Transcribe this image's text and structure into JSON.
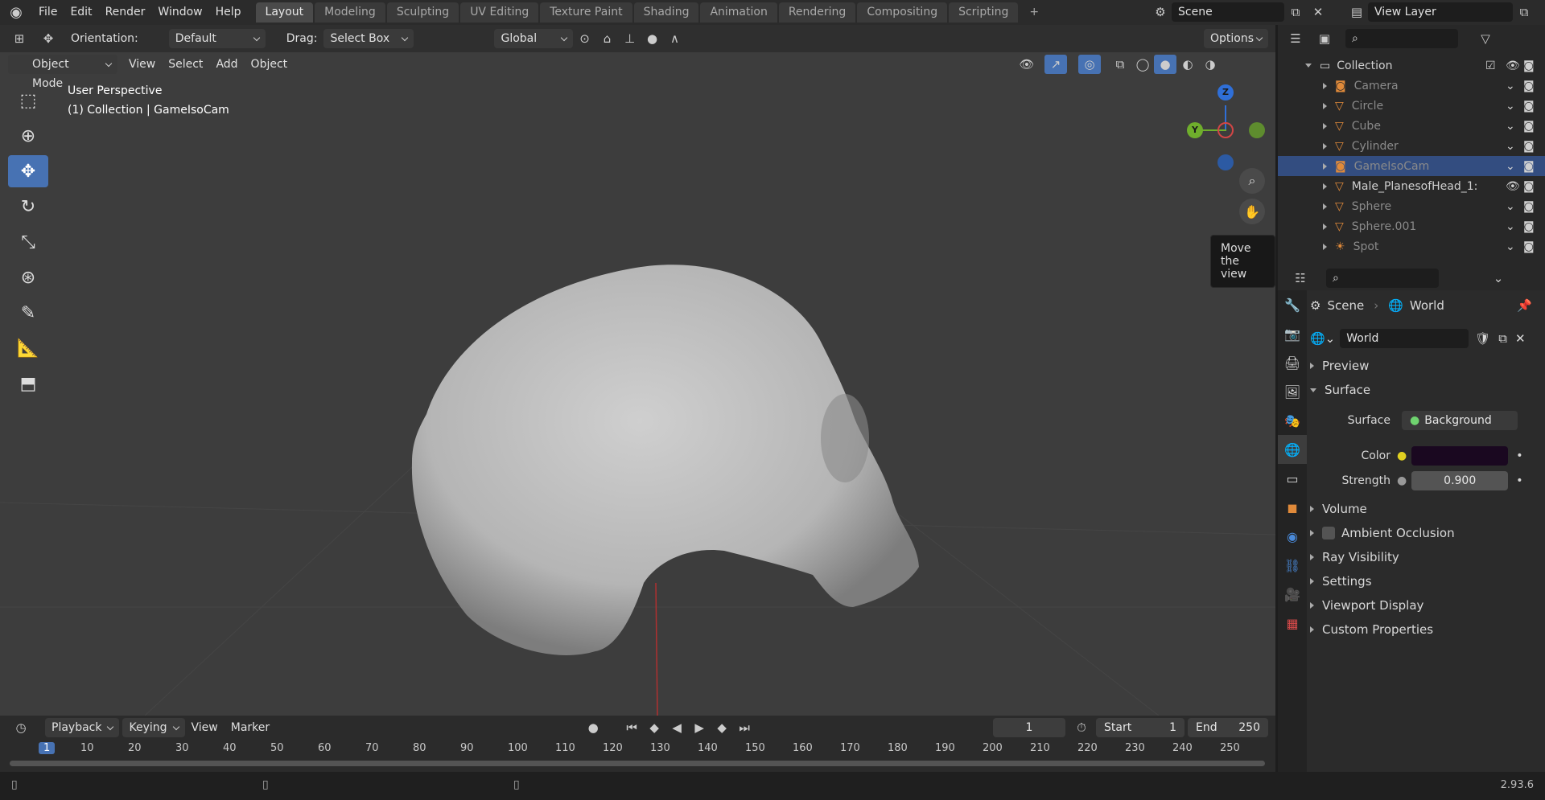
{
  "topbar": {
    "menus": [
      "File",
      "Edit",
      "Render",
      "Window",
      "Help"
    ],
    "workspaces": [
      "Layout",
      "Modeling",
      "Sculpting",
      "UV Editing",
      "Texture Paint",
      "Shading",
      "Animation",
      "Rendering",
      "Compositing",
      "Scripting"
    ],
    "active_workspace": "Layout",
    "add_tab": "+",
    "scene": "Scene",
    "view_layer": "View Layer"
  },
  "header": {
    "orientation_label": "Orientation:",
    "orientation_value": "Default",
    "drag_label": "Drag:",
    "drag_value": "Select Box",
    "transform_space": "Global",
    "options": "Options"
  },
  "header2": {
    "mode": "Object Mode",
    "menus": [
      "View",
      "Select",
      "Add",
      "Object"
    ]
  },
  "viewport": {
    "perspective": "User Perspective",
    "collection_info": "(1) Collection | GameIsoCam",
    "tooltip": "Move the view",
    "gizmo": {
      "z": "Z",
      "y": "Y"
    }
  },
  "timeline": {
    "menus": [
      "Playback",
      "Keying",
      "View",
      "Marker"
    ],
    "current_frame": "1",
    "start_label": "Start",
    "start": "1",
    "end_label": "End",
    "end": "250",
    "ticks": [
      "1",
      "10",
      "20",
      "30",
      "40",
      "50",
      "60",
      "70",
      "80",
      "90",
      "100",
      "110",
      "120",
      "130",
      "140",
      "150",
      "160",
      "170",
      "180",
      "190",
      "200",
      "210",
      "220",
      "230",
      "240",
      "250"
    ]
  },
  "status": {
    "version": "2.93.6"
  },
  "outliner": {
    "collection": "Collection",
    "items": [
      {
        "name": "Camera",
        "icon": "camera-icon",
        "dim": true
      },
      {
        "name": "Circle",
        "icon": "mesh-icon",
        "dim": true
      },
      {
        "name": "Cube",
        "icon": "mesh-icon",
        "dim": true
      },
      {
        "name": "Cylinder",
        "icon": "mesh-icon",
        "dim": true
      },
      {
        "name": "GameIsoCam",
        "icon": "camera-icon",
        "dim": true,
        "selected": true
      },
      {
        "name": "Male_PlanesofHead_1:",
        "icon": "mesh-icon",
        "dim": false
      },
      {
        "name": "Sphere",
        "icon": "mesh-icon",
        "dim": true
      },
      {
        "name": "Sphere.001",
        "icon": "mesh-icon",
        "dim": true
      },
      {
        "name": "Spot",
        "icon": "light-icon",
        "dim": true
      }
    ]
  },
  "properties": {
    "breadcrumb_scene": "Scene",
    "breadcrumb_world": "World",
    "world_name": "World",
    "panels": {
      "preview": "Preview",
      "surface": "Surface",
      "volume": "Volume",
      "ambient_occlusion": "Ambient Occlusion",
      "ray_visibility": "Ray Visibility",
      "settings": "Settings",
      "viewport_display": "Viewport Display",
      "custom_properties": "Custom Properties"
    },
    "surface_label": "Surface",
    "surface_value": "Background",
    "color_label": "Color",
    "color_value": "#1a0820",
    "strength_label": "Strength",
    "strength_value": "0.900"
  },
  "colors": {
    "accent": "#4772b3",
    "background": "#3d3d3d",
    "selected_row": "#334d80"
  }
}
